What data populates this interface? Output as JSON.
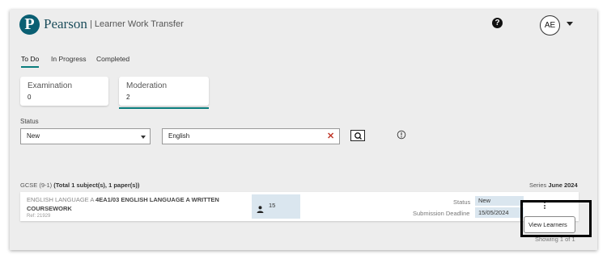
{
  "header": {
    "brand": "Pearson",
    "app_title": "| Learner Work Transfer",
    "help_icon": "question-circle-icon",
    "user_initials": "AE"
  },
  "tabs": [
    {
      "label": "To Do",
      "active": true
    },
    {
      "label": "In Progress",
      "active": false
    },
    {
      "label": "Completed",
      "active": false
    }
  ],
  "cards": [
    {
      "label": "Examination",
      "count": "0",
      "active": false
    },
    {
      "label": "Moderation",
      "count": "2",
      "active": true
    }
  ],
  "filters": {
    "status_label": "Status",
    "status_value": "New",
    "search_value": "English"
  },
  "group": {
    "prefix": "GCSE (9-1)",
    "summary": "(Total 1 subject(s), 1 paper(s))",
    "series_label": "Series",
    "series_value": "June 2024"
  },
  "row": {
    "subject_prefix": "ENGLISH LANGUAGE A",
    "subject_bold": "4EA1/03 ENGLISH LANGUAGE A WRITTEN COURSEWORK",
    "ref": "Ref: 21929",
    "learners": "15",
    "status_label": "Status",
    "status_value": "New",
    "deadline_label": "Submission Deadline",
    "deadline_value": "15/05/2024"
  },
  "menu": {
    "view_learners": "View Learners"
  },
  "pagination": {
    "showing": "Showing 1 of 1"
  },
  "colors": {
    "brand_teal": "#0a5f73",
    "accent": "#0a7d7d",
    "highlight_blue": "#dae6ef"
  }
}
